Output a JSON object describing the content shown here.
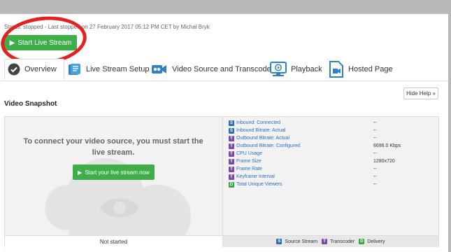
{
  "status": "Status: stopped - Last stopped on 27 February 2017 05:12 PM CET by Michal Bryk",
  "start_button": "Start Live Stream",
  "tabs": [
    {
      "label": "Overview"
    },
    {
      "label": "Live Stream Setup"
    },
    {
      "label": "Video Source and Transcoder"
    },
    {
      "label": "Playback"
    },
    {
      "label": "Hosted Page"
    }
  ],
  "help_button": "Hide Help »",
  "snapshot": {
    "title": "Video Snapshot",
    "message": "To connect your video source, you must start the live stream.",
    "start_stream_button": "Start your live stream now",
    "state": "Not started"
  },
  "metrics": [
    {
      "badge": "S",
      "badge_color": "#2d6db3",
      "label": "Inbound: Connected",
      "value": "--"
    },
    {
      "badge": "S",
      "badge_color": "#2d6db3",
      "label": "Inbound Bitrate: Actual",
      "value": "--"
    },
    {
      "badge": "T",
      "badge_color": "#7b4aa1",
      "label": "Outbound Bitrate: Actual",
      "value": "--"
    },
    {
      "badge": "T",
      "badge_color": "#7b4aa1",
      "label": "Outbound Bitrate: Configured",
      "value": "6696.0 Kbps"
    },
    {
      "badge": "T",
      "badge_color": "#7b4aa1",
      "label": "CPU Usage",
      "value": "--"
    },
    {
      "badge": "T",
      "badge_color": "#7b4aa1",
      "label": "Frame Size",
      "value": "1280x720"
    },
    {
      "badge": "T",
      "badge_color": "#7b4aa1",
      "label": "Frame Rate",
      "value": "--"
    },
    {
      "badge": "T",
      "badge_color": "#7b4aa1",
      "label": "Keyframe Interval",
      "value": "--"
    },
    {
      "badge": "D",
      "badge_color": "#36a843",
      "label": "Total Unique Viewers",
      "value": "--"
    }
  ],
  "legend": {
    "source_badge": "S",
    "source": "Source Stream",
    "transcoder_badge": "T",
    "transcoder": "Transcoder",
    "delivery_badge": "D",
    "delivery": "Delivery"
  },
  "colors": {
    "green": "#3fae49",
    "blue": "#2d6db3",
    "purple": "#7b4aa1",
    "red_circle": "#e52020"
  }
}
